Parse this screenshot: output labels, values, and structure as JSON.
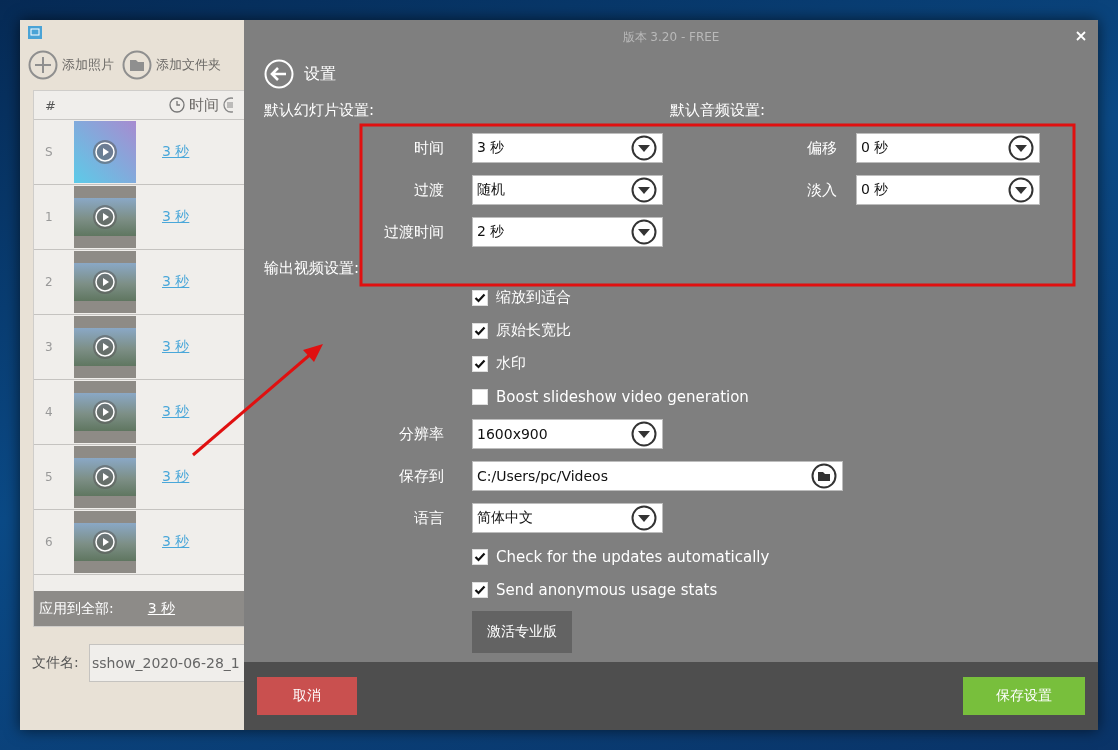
{
  "window": {
    "title": "版本 3.20 - FREE"
  },
  "left_pane": {
    "toolbar": [
      {
        "label": "添加照片",
        "kind": "add"
      },
      {
        "label": "添加文件夹",
        "kind": "folder"
      }
    ],
    "table": {
      "columns": [
        {
          "label": "#",
          "kind": "number"
        },
        {
          "label": "时间",
          "kind": "time"
        }
      ],
      "rows": [
        {
          "number": "S",
          "duration": "3 秒",
          "kind": "gradient"
        },
        {
          "number": "1",
          "duration": "3 秒",
          "kind": "photo"
        },
        {
          "number": "2",
          "duration": "3 秒",
          "kind": "photo"
        },
        {
          "number": "3",
          "duration": "3 秒",
          "kind": "photo"
        },
        {
          "number": "4",
          "duration": "3 秒",
          "kind": "photo"
        },
        {
          "number": "5",
          "duration": "3 秒",
          "kind": "photo"
        },
        {
          "number": "6",
          "duration": "3 秒",
          "kind": "photo"
        }
      ]
    },
    "apply_all": {
      "label": "应用到全部:",
      "duration": "3 秒"
    },
    "filename": {
      "label": "文件名:",
      "value": "sshow_2020-06-28_1"
    }
  },
  "settings": {
    "title": "设置",
    "slideshow": {
      "heading": "默认幻灯片设置:",
      "fields": [
        {
          "label": "时间",
          "value": "3 秒"
        },
        {
          "label": "过渡",
          "value": "随机"
        },
        {
          "label": "过渡时间",
          "value": "2 秒"
        }
      ]
    },
    "audio": {
      "heading": "默认音频设置:",
      "fields": [
        {
          "label": "偏移",
          "value": "0 秒"
        },
        {
          "label": "淡入",
          "value": "0 秒"
        }
      ]
    },
    "output": {
      "heading": "输出视频设置:",
      "items": [
        {
          "kind": "checkbox",
          "label": "缩放到适合",
          "checked": true
        },
        {
          "kind": "checkbox",
          "label": "原始长宽比",
          "checked": true
        },
        {
          "kind": "checkbox",
          "label": "水印",
          "checked": true
        },
        {
          "kind": "checkbox",
          "label": "Boost slideshow video generation",
          "checked": false
        },
        {
          "kind": "select",
          "label": "分辨率",
          "value": "1600x900"
        },
        {
          "kind": "folder",
          "label": "保存到",
          "value": "C:/Users/pc/Videos"
        },
        {
          "kind": "select",
          "label": "语言",
          "value": "简体中文"
        },
        {
          "kind": "checkbox",
          "label": "Check for the updates automatically",
          "checked": true
        },
        {
          "kind": "checkbox",
          "label": "Send anonymous usage stats",
          "checked": true
        },
        {
          "kind": "button",
          "label": "激活专业版"
        }
      ]
    }
  },
  "buttons": [
    {
      "label": "取消",
      "kind": "cancel"
    },
    {
      "label": "保存设置",
      "kind": "save"
    }
  ]
}
